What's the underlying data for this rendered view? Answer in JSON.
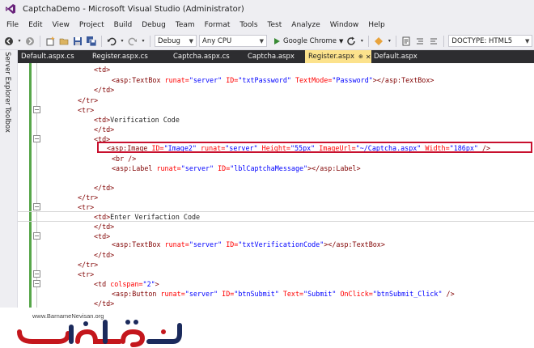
{
  "window": {
    "title": "CaptchaDemo - Microsoft Visual Studio (Administrator)"
  },
  "menu": {
    "items": [
      "File",
      "Edit",
      "View",
      "Project",
      "Build",
      "Debug",
      "Team",
      "Format",
      "Tools",
      "Test",
      "Analyze",
      "Window",
      "Help"
    ]
  },
  "toolbar": {
    "config": "Debug",
    "platform": "Any CPU",
    "run_label": "Google Chrome",
    "doctype": "DOCTYPE: HTML5"
  },
  "sidebar": {
    "server_explorer": "Server Explorer",
    "toolbox": "Toolbox"
  },
  "tabs": [
    {
      "label": "Default.aspx.cs",
      "active": false
    },
    {
      "label": "Register.aspx.cs",
      "active": false
    },
    {
      "label": "Captcha.aspx.cs",
      "active": false
    },
    {
      "label": "Captcha.aspx",
      "active": false
    },
    {
      "label": "Register.aspx",
      "active": true
    },
    {
      "label": "Default.aspx",
      "active": false
    }
  ],
  "code": {
    "l1": "<td>",
    "l2_tag": "<asp:TextBox",
    "l2_a1": "runat=",
    "l2_v1": "\"server\"",
    "l2_a2": "ID=",
    "l2_v2": "\"txtPassword\"",
    "l2_a3": "TextMode=",
    "l2_v3": "\"Password\"",
    "l2_end": "></asp:TextBox>",
    "l3": "</td>",
    "l4": "</tr>",
    "l5": "<tr>",
    "l6_tag": "<td>",
    "l6_txt": "Verification Code",
    "l7": "</td>",
    "l8": "<td>",
    "l9_tag": "<asp:Image",
    "l9_a1": "ID=",
    "l9_v1": "\"Image2\"",
    "l9_a2": "runat=",
    "l9_v2": "\"server\"",
    "l9_a3": "Height=",
    "l9_v3": "\"55px\"",
    "l9_a4": "ImageUrl=",
    "l9_v4": "\"~/Captcha.aspx\"",
    "l9_a5": "Width=",
    "l9_v5": "\"186px\"",
    "l9_end": "/>",
    "l10": "<br />",
    "l11_tag": "<asp:Label",
    "l11_a1": "runat=",
    "l11_v1": "\"server\"",
    "l11_a2": "ID=",
    "l11_v2": "\"lblCaptchaMessage\"",
    "l11_end": "></asp:Label>",
    "l13": "</td>",
    "l14": "</tr>",
    "l15": "<tr>",
    "l16_tag": "<td>",
    "l16_txt": "Enter Verifaction Code",
    "l17": "</td>",
    "l18": "<td>",
    "l19_tag": "<asp:TextBox",
    "l19_a1": "runat=",
    "l19_v1": "\"server\"",
    "l19_a2": "ID=",
    "l19_v2": "\"txtVerificationCode\"",
    "l19_end": "></asp:TextBox>",
    "l20": "</td>",
    "l21": "</tr>",
    "l22": "<tr>",
    "l23_tag": "<td",
    "l23_a1": "colspan=",
    "l23_v1": "\"2\"",
    "l23_end": ">",
    "l24_tag": "<asp:Button",
    "l24_a1": "runat=",
    "l24_v1": "\"server\"",
    "l24_a2": "ID=",
    "l24_v2": "\"btnSubmit\"",
    "l24_a3": "Text=",
    "l24_v3": "\"Submit\"",
    "l24_a4": "OnClick=",
    "l24_v4": "\"btnSubmit_Click\"",
    "l24_end": "/>",
    "l25": "</td>"
  },
  "watermark": {
    "url": "www.BarnameNevisan.org"
  },
  "colors": {
    "tag": "#800000",
    "attribute": "#ff0000",
    "value": "#0000ff",
    "highlight_border": "#c8102e",
    "active_tab": "#fce28c",
    "tab_bar": "#2d2d30",
    "watermark_red": "#c4161c",
    "watermark_navy": "#1b2a5c"
  }
}
